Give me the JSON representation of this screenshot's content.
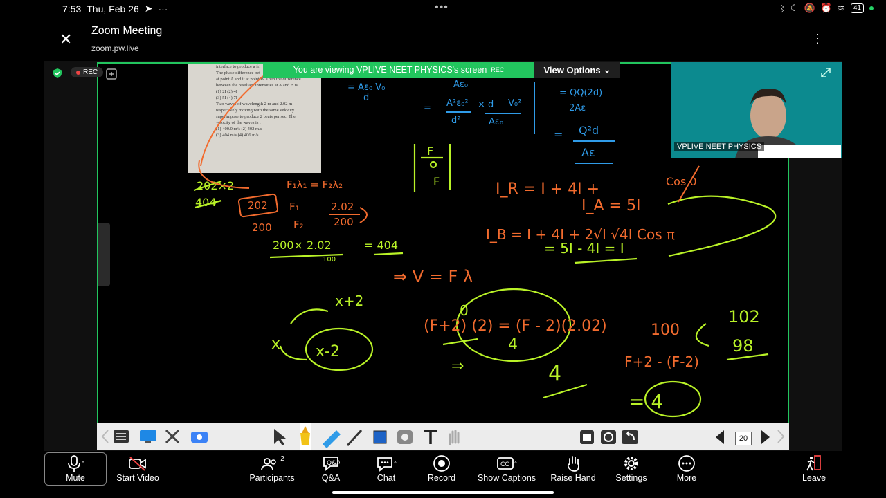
{
  "status": {
    "time": "7:53",
    "date": "Thu, Feb 26",
    "extra": "···",
    "battery": "41"
  },
  "header": {
    "title": "Zoom Meeting",
    "subtitle": "zoom.pw.live"
  },
  "share": {
    "rec_label": "REC",
    "banner_text": "You are viewing  VPLIVE NEET PHYSICS's screen",
    "banner_rec": "REC",
    "view_options": "View Options",
    "presenter_name": "VPLIVE NEET PHYSICS",
    "page_number": "20"
  },
  "whiteboard": {
    "question_lines": [
      "interface to produce a fri",
      "The phase difference bet",
      "at point A and it at point B. Then the difference",
      "between the resultant intensities at A and B is",
      "(1) 2I         (2) 4I",
      "(3) 5I         (4) 7I",
      "Two waves of wavelength 2 m and 2.02 m",
      "respectively moving with the same velocity",
      "superimpose to produce 2 beats per sec. The",
      "velocity of the waves is :",
      "(1) 400.0 m/s     (2) 402 m/s",
      "(3) 404 m/s       (4) 406 m/s"
    ],
    "ink": {
      "aeo_v0": "= Aε₀ V₀",
      "aeo_d": "d",
      "top_aeo": "Aε₀",
      "frac1_num": "A²ε₀²",
      "frac1_den": "d²",
      "times_d": "× d",
      "v02": "V₀²",
      "frac2_den": "Aε₀",
      "eq_mid": "=",
      "q_top": "= QQ(2d)",
      "q_top_den": "2Aε",
      "q_res_num": "Q²d",
      "q_res_den": "Aε",
      "eq_right": "=",
      "f_label1": "F",
      "f_label2": "F",
      "calc1": "202×2",
      "calc1b": "404",
      "f1l1": "F₁λ₁ = F₂λ₂",
      "f1": "F₁",
      "f2": "F₂",
      "n202": "202",
      "n200": "200",
      "frac202": "2.02",
      "frac200": "200",
      "calc2": "200× 2.02",
      "calc2b": "100",
      "res404": "= 404",
      "ir": "I_R = I + 4I +",
      "cos0": "Cos 0",
      "ia": "I_A = 5I",
      "ib": "I_B = I + 4I + 2√I √4I Cos π",
      "ib2": "= 5I - 4I = I",
      "v_eq": "⇒  V = F λ",
      "x2top": "x+2",
      "x_left": "x",
      "x2bot": "x-2",
      "fp2": "(F+2) (2) = (F - 2)(2.02)",
      "zero": "0",
      "four_a": "4",
      "arrow_l": "⇒",
      "four_b": "4",
      "hundred": "100",
      "n102": "102",
      "n98": "98",
      "fp2b": "F+2  - (F-2)",
      "four_c": "= 4"
    }
  },
  "bottom_bar": {
    "mute": "Mute",
    "start_video": "Start Video",
    "participants": "Participants",
    "participants_count": "2",
    "qa": "Q&A",
    "chat": "Chat",
    "record": "Record",
    "show_captions": "Show Captions",
    "raise_hand": "Raise Hand",
    "settings": "Settings",
    "more": "More",
    "leave": "Leave"
  },
  "colors": {
    "accent_green": "#22c55e",
    "ink_orange": "#f26b2e",
    "ink_green": "#b9f227",
    "ink_blue": "#2f9be8",
    "video_bg": "#0c8a8f"
  }
}
